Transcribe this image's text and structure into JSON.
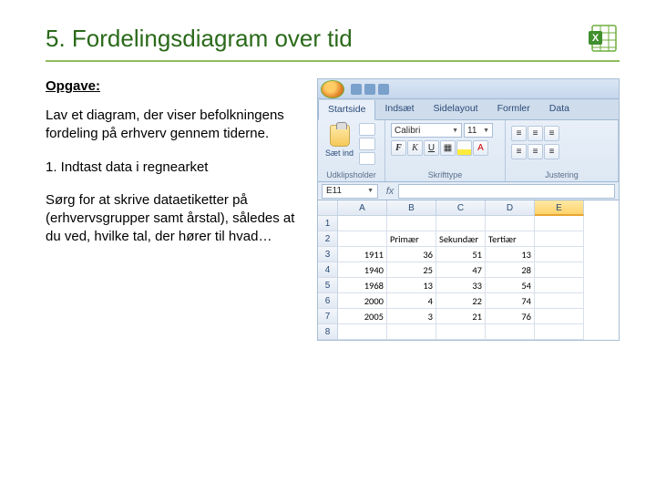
{
  "title": "5. Fordelingsdiagram over tid",
  "logo_letter": "X",
  "left": {
    "subhead": "Opgave:",
    "p1": "Lav et diagram, der viser befolkningens fordeling på erhverv gennem tiderne.",
    "p2": "1. Indtast data i regnearket",
    "p3": "Sørg for at skrive dataetiketter på (erhvervsgrupper samt årstal), således at du ved, hvilke tal, der hører til hvad…"
  },
  "excel": {
    "tabs": [
      "Startside",
      "Indsæt",
      "Sidelayout",
      "Formler",
      "Data"
    ],
    "active_tab": 0,
    "paste_label": "Sæt ind",
    "groups": {
      "clipboard": "Udklipsholder",
      "font": "Skrifttype",
      "align": "Justering"
    },
    "font_name": "Calibri",
    "font_size": "11",
    "namebox": "E11",
    "fx": "fx",
    "cols": [
      "A",
      "B",
      "C",
      "D",
      "E"
    ],
    "rows": [
      [
        "",
        "",
        "",
        "",
        ""
      ],
      [
        "",
        "Primær",
        "Sekundær",
        "Tertiær",
        ""
      ],
      [
        "1911",
        "36",
        "51",
        "13",
        ""
      ],
      [
        "1940",
        "25",
        "47",
        "28",
        ""
      ],
      [
        "1968",
        "13",
        "33",
        "54",
        ""
      ],
      [
        "2000",
        "4",
        "22",
        "74",
        ""
      ],
      [
        "2005",
        "3",
        "21",
        "76",
        ""
      ],
      [
        "",
        "",
        "",
        "",
        ""
      ]
    ],
    "text_cols": [
      1,
      2,
      3
    ],
    "text_row": 1
  },
  "font_buttons": {
    "b": "F",
    "i": "K",
    "u": "U"
  }
}
